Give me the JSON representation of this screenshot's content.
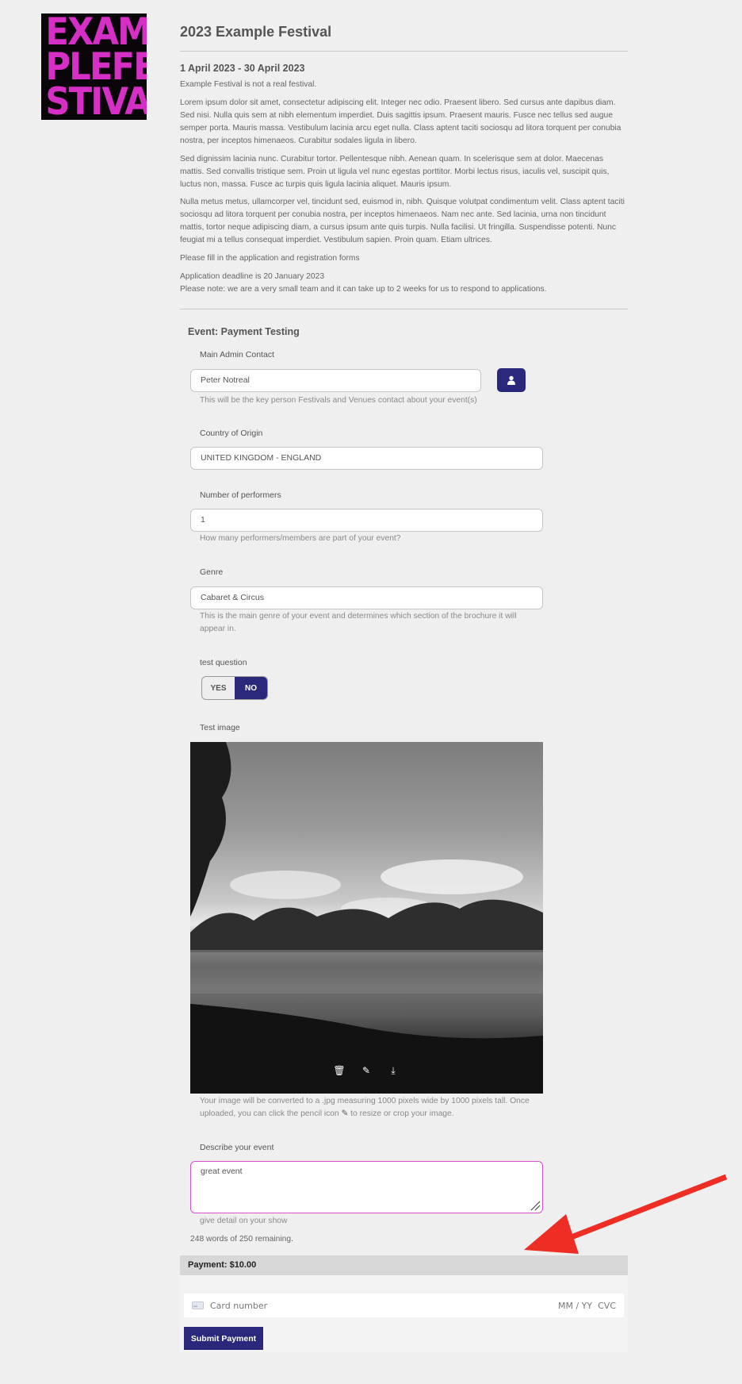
{
  "logo": {
    "lines": [
      "EXAM",
      "PLEFE",
      "STIVAL"
    ]
  },
  "festival": {
    "title": "2023 Example Festival",
    "dates": "1 April 2023 - 30 April 2023",
    "intro": "Example Festival is not a real festival.",
    "paragraph1": "Lorem ipsum dolor sit amet, consectetur adipiscing elit. Integer nec odio. Praesent libero. Sed cursus ante dapibus diam. Sed nisi. Nulla quis sem at nibh elementum imperdiet. Duis sagittis ipsum. Praesent mauris. Fusce nec tellus sed augue semper porta. Mauris massa. Vestibulum lacinia arcu eget nulla. Class aptent taciti sociosqu ad litora torquent per conubia nostra, per inceptos himenaeos. Curabitur sodales ligula in libero.",
    "paragraph2": "Sed dignissim lacinia nunc. Curabitur tortor. Pellentesque nibh. Aenean quam. In scelerisque sem at dolor. Maecenas mattis. Sed convallis tristique sem. Proin ut ligula vel nunc egestas porttitor. Morbi lectus risus, iaculis vel, suscipit quis, luctus non, massa. Fusce ac turpis quis ligula lacinia aliquet. Mauris ipsum.",
    "paragraph3": "Nulla metus metus, ullamcorper vel, tincidunt sed, euismod in, nibh. Quisque volutpat condimentum velit. Class aptent taciti sociosqu ad litora torquent per conubia nostra, per inceptos himenaeos. Nam nec ante. Sed lacinia, urna non tincidunt mattis, tortor neque adipiscing diam, a cursus ipsum ante quis turpis. Nulla facilisi. Ut fringilla. Suspendisse potenti. Nunc feugiat mi a tellus consequat imperdiet. Vestibulum sapien. Proin quam. Etiam ultrices.",
    "fill_forms": "Please fill in the application and registration forms",
    "deadline": "Application deadline is 20 January 2023",
    "note": "Please note: we are a very small team and it can take up to 2 weeks for us to respond to applications."
  },
  "form": {
    "event_title": "Event: Payment Testing",
    "admin_contact": {
      "label": "Main Admin Contact",
      "value": "Peter Notreal",
      "help": "This will be the key person Festivals and Venues contact about your event(s)"
    },
    "country": {
      "label": "Country of Origin",
      "value": "UNITED KINGDOM - ENGLAND"
    },
    "performers": {
      "label": "Number of performers",
      "value": "1",
      "help": "How many performers/members are part of your event?"
    },
    "genre": {
      "label": "Genre",
      "value": "Cabaret & Circus",
      "help_line1": "This is the main genre of your event and determines which section of the brochure it will",
      "help_line2": "appear in."
    },
    "test_question": {
      "label": "test question",
      "yes": "YES",
      "no": "NO",
      "selected": "NO"
    },
    "test_image": {
      "label": "Test image",
      "help_line1": "Your image will be converted to a .jpg measuring 1000 pixels wide by 1000 pixels tall. Once",
      "help_line2_a": "uploaded, you can click the pencil icon",
      "help_line2_b": "to resize or crop your image."
    },
    "describe": {
      "label": "Describe your event",
      "value": "great event",
      "help": "give detail on your show",
      "word_count": "248 words of 250 remaining."
    }
  },
  "payment": {
    "header": "Payment: $10.00",
    "card_placeholder": "Card number",
    "expiry_cvc": "MM / YY  CVC",
    "submit": "Submit Payment"
  },
  "colors": {
    "accent": "#29287a",
    "logo_magenta": "#d52fc6",
    "annotation_arrow": "#ee2e24"
  }
}
